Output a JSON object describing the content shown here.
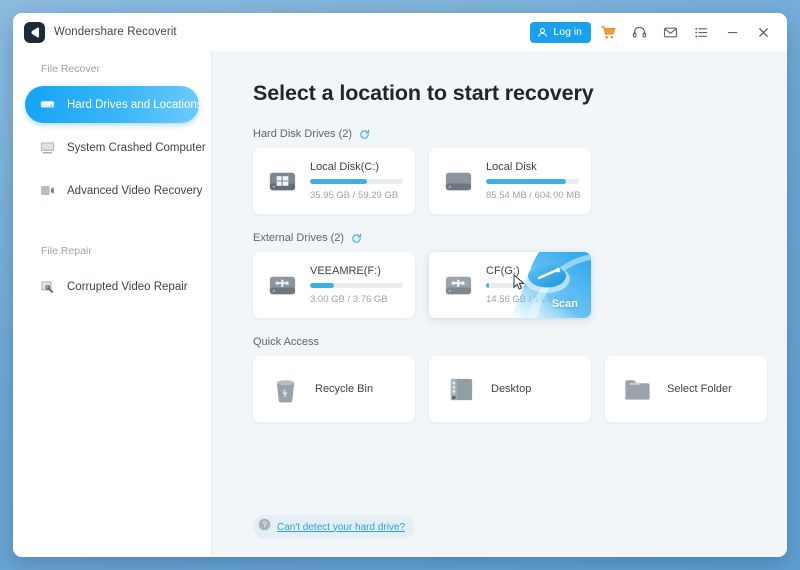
{
  "app": {
    "title": "Wondershare Recoverit",
    "logo_icon": "recoverit-logo-icon"
  },
  "titlebar": {
    "login_label": "Log in",
    "icons": {
      "user": "user-icon",
      "cart": "shopping-cart-icon",
      "support": "headset-icon",
      "mail": "mail-icon",
      "menu": "list-menu-icon",
      "minimize": "minimize-icon",
      "close": "close-icon"
    }
  },
  "sidebar": {
    "groups": [
      {
        "label": "File Recover",
        "items": [
          {
            "label": "Hard Drives and Locations",
            "icon": "hard-drive-icon",
            "active": true
          },
          {
            "label": "System Crashed Computer",
            "icon": "monitor-icon",
            "active": false
          },
          {
            "label": "Advanced Video Recovery",
            "icon": "video-film-icon",
            "active": false
          }
        ]
      },
      {
        "label": "File Repair",
        "items": [
          {
            "label": "Corrupted Video Repair",
            "icon": "video-repair-icon",
            "active": false
          }
        ]
      }
    ]
  },
  "main": {
    "page_title": "Select a location to start recovery",
    "sections": [
      {
        "heading": "Hard Disk Drives (2)",
        "refresh_icon": "refresh-icon",
        "cards": [
          {
            "name": "Local Disk(C:)",
            "size_text": "35.95 GB / 59.29 GB",
            "fill_percent": 61,
            "icon": "windows-disk-icon",
            "hovered": false
          },
          {
            "name": "Local Disk",
            "size_text": "85.54 MB / 604.00 MB",
            "fill_percent": 86,
            "icon": "local-disk-icon",
            "hovered": false
          }
        ]
      },
      {
        "heading": "External Drives (2)",
        "refresh_icon": "refresh-icon",
        "cards": [
          {
            "name": "VEEAMRE(F:)",
            "size_text": "3.00 GB / 3.76 GB",
            "fill_percent": 26,
            "icon": "usb-drive-icon",
            "hovered": false
          },
          {
            "name": "CF(G:)",
            "size_text": "14.56 GB / 14.84 GB",
            "fill_percent": 3,
            "icon": "usb-drive-icon",
            "hovered": true,
            "scan_label": "Scan"
          }
        ]
      }
    ],
    "quick_access": {
      "heading": "Quick Access",
      "items": [
        {
          "label": "Recycle Bin",
          "icon": "recycle-bin-icon"
        },
        {
          "label": "Desktop",
          "icon": "desktop-icon"
        },
        {
          "label": "Select Folder",
          "icon": "folder-icon"
        }
      ]
    },
    "help": {
      "text": "Can't detect your hard drive?",
      "icon": "question-mark-icon"
    }
  },
  "colors": {
    "accent": "#1aa0ec",
    "accent_light": "#6ecbfb",
    "progress": "#3fb1de",
    "cart": "#f07a12",
    "main_bg": "#f2f6f8"
  }
}
